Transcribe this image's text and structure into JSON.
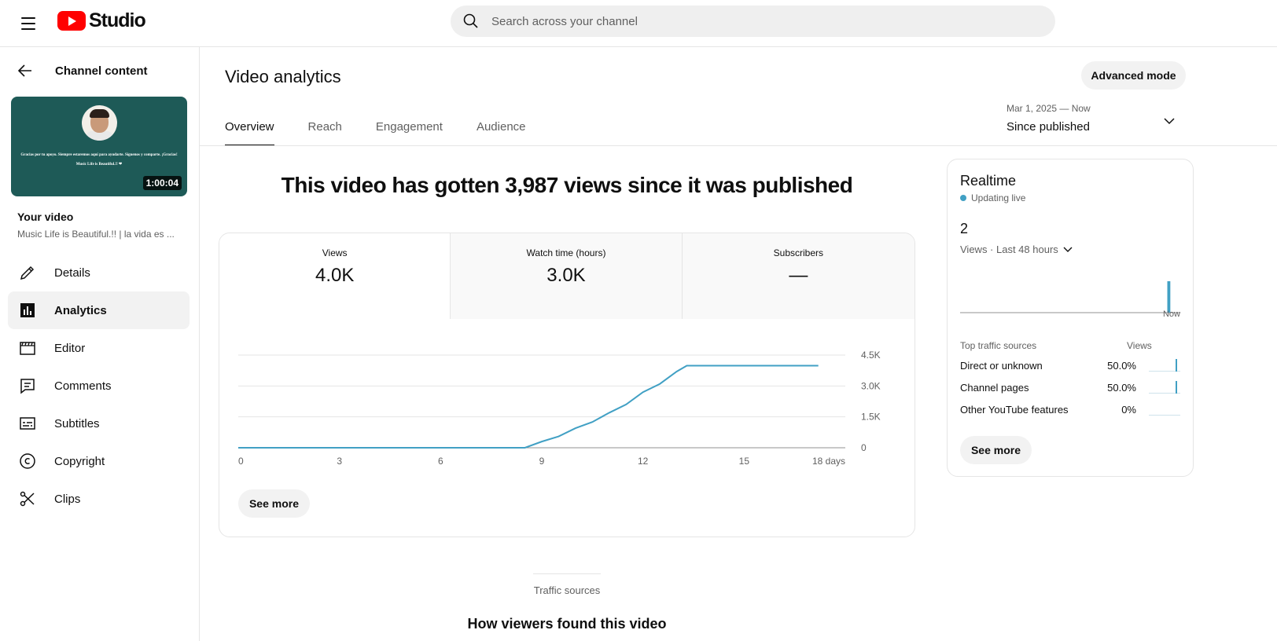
{
  "header": {
    "logo_text": "Studio",
    "search_placeholder": "Search across your channel"
  },
  "sidebar": {
    "back_label": "Channel content",
    "thumbnail": {
      "caption_line1": "Gracias por tu apoyo. Siempre estaremos aquí para ayudarte. Síguenos y comparte. ¡Gracias!",
      "caption_line2": "Music Life is Beautiful.!! ❤",
      "duration": "1:00:04"
    },
    "your_video_label": "Your video",
    "video_title": "Music Life is Beautiful.!! | la vida es ...",
    "items": [
      {
        "label": "Details",
        "icon": "pencil-icon"
      },
      {
        "label": "Analytics",
        "icon": "analytics-icon",
        "active": true
      },
      {
        "label": "Editor",
        "icon": "editor-icon"
      },
      {
        "label": "Comments",
        "icon": "comments-icon"
      },
      {
        "label": "Subtitles",
        "icon": "subtitles-icon"
      },
      {
        "label": "Copyright",
        "icon": "copyright-icon"
      },
      {
        "label": "Clips",
        "icon": "scissors-icon"
      }
    ]
  },
  "main": {
    "title": "Video analytics",
    "advanced_mode": "Advanced mode",
    "tabs": [
      {
        "label": "Overview",
        "active": true
      },
      {
        "label": "Reach"
      },
      {
        "label": "Engagement"
      },
      {
        "label": "Audience"
      }
    ],
    "date_range": {
      "dates": "Mar 1, 2025 — Now",
      "label": "Since published"
    },
    "headline": "This video has gotten 3,987 views since it was published",
    "metrics": [
      {
        "label": "Views",
        "value": "4.0K"
      },
      {
        "label": "Watch time (hours)",
        "value": "3.0K"
      },
      {
        "label": "Subscribers",
        "value": "—"
      }
    ],
    "see_more": "See more"
  },
  "chart_data": {
    "type": "line",
    "xlabel": "",
    "ylabel": "",
    "x_ticks": [
      "0",
      "3",
      "6",
      "9",
      "12",
      "15",
      "18 days"
    ],
    "y_ticks": [
      "0",
      "1.5K",
      "3.0K",
      "4.5K"
    ],
    "xlim": [
      0,
      18
    ],
    "ylim": [
      0,
      4500
    ],
    "grid": true,
    "color": "#41a0c4",
    "series": [
      {
        "x": [
          0,
          1,
          2,
          3,
          4,
          5,
          6,
          7,
          8,
          8.5,
          9,
          9.5,
          10,
          10.5,
          11,
          11.5,
          12,
          12.5,
          13,
          13.3,
          14,
          15,
          16,
          17,
          17.2
        ],
        "values": [
          0,
          0,
          0,
          0,
          0,
          0,
          0,
          0,
          0,
          0,
          300,
          550,
          950,
          1250,
          1700,
          2100,
          2700,
          3100,
          3700,
          3987,
          3987,
          3987,
          3987,
          3987,
          3987
        ]
      }
    ]
  },
  "realtime": {
    "title": "Realtime",
    "status": "Updating live",
    "count": "2",
    "period": "Views · Last 48 hours",
    "now_label": "Now",
    "bars": [
      0,
      0,
      0,
      0,
      0,
      0,
      0,
      0,
      0,
      0,
      0,
      0,
      0,
      0,
      0,
      0,
      0,
      0,
      0,
      0,
      0,
      0,
      0,
      0,
      0,
      0,
      0,
      0,
      0,
      0,
      0,
      0,
      0,
      0,
      0,
      0,
      0,
      0,
      0,
      0,
      0,
      0,
      0,
      0,
      0,
      2,
      0,
      0
    ],
    "table_header": {
      "source": "Top traffic sources",
      "views": "Views"
    },
    "sources": [
      {
        "name": "Direct or unknown",
        "pct": "50.0%",
        "has_bar": true
      },
      {
        "name": "Channel pages",
        "pct": "50.0%",
        "has_bar": true
      },
      {
        "name": "Other YouTube features",
        "pct": "0%",
        "has_bar": false
      }
    ],
    "see_more": "See more"
  },
  "traffic": {
    "label": "Traffic sources",
    "heading": "How viewers found this video"
  }
}
